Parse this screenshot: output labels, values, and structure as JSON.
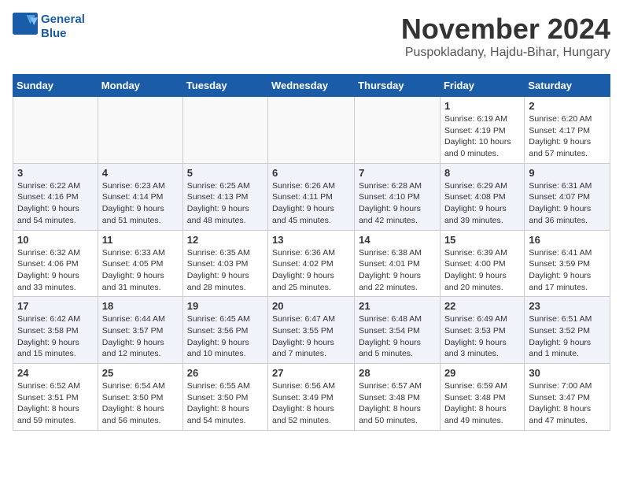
{
  "header": {
    "logo_line1": "General",
    "logo_line2": "Blue",
    "month_year": "November 2024",
    "location": "Puspokladany, Hajdu-Bihar, Hungary"
  },
  "weekdays": [
    "Sunday",
    "Monday",
    "Tuesday",
    "Wednesday",
    "Thursday",
    "Friday",
    "Saturday"
  ],
  "weeks": [
    [
      {
        "day": "",
        "info": ""
      },
      {
        "day": "",
        "info": ""
      },
      {
        "day": "",
        "info": ""
      },
      {
        "day": "",
        "info": ""
      },
      {
        "day": "",
        "info": ""
      },
      {
        "day": "1",
        "info": "Sunrise: 6:19 AM\nSunset: 4:19 PM\nDaylight: 10 hours\nand 0 minutes."
      },
      {
        "day": "2",
        "info": "Sunrise: 6:20 AM\nSunset: 4:17 PM\nDaylight: 9 hours\nand 57 minutes."
      }
    ],
    [
      {
        "day": "3",
        "info": "Sunrise: 6:22 AM\nSunset: 4:16 PM\nDaylight: 9 hours\nand 54 minutes."
      },
      {
        "day": "4",
        "info": "Sunrise: 6:23 AM\nSunset: 4:14 PM\nDaylight: 9 hours\nand 51 minutes."
      },
      {
        "day": "5",
        "info": "Sunrise: 6:25 AM\nSunset: 4:13 PM\nDaylight: 9 hours\nand 48 minutes."
      },
      {
        "day": "6",
        "info": "Sunrise: 6:26 AM\nSunset: 4:11 PM\nDaylight: 9 hours\nand 45 minutes."
      },
      {
        "day": "7",
        "info": "Sunrise: 6:28 AM\nSunset: 4:10 PM\nDaylight: 9 hours\nand 42 minutes."
      },
      {
        "day": "8",
        "info": "Sunrise: 6:29 AM\nSunset: 4:08 PM\nDaylight: 9 hours\nand 39 minutes."
      },
      {
        "day": "9",
        "info": "Sunrise: 6:31 AM\nSunset: 4:07 PM\nDaylight: 9 hours\nand 36 minutes."
      }
    ],
    [
      {
        "day": "10",
        "info": "Sunrise: 6:32 AM\nSunset: 4:06 PM\nDaylight: 9 hours\nand 33 minutes."
      },
      {
        "day": "11",
        "info": "Sunrise: 6:33 AM\nSunset: 4:05 PM\nDaylight: 9 hours\nand 31 minutes."
      },
      {
        "day": "12",
        "info": "Sunrise: 6:35 AM\nSunset: 4:03 PM\nDaylight: 9 hours\nand 28 minutes."
      },
      {
        "day": "13",
        "info": "Sunrise: 6:36 AM\nSunset: 4:02 PM\nDaylight: 9 hours\nand 25 minutes."
      },
      {
        "day": "14",
        "info": "Sunrise: 6:38 AM\nSunset: 4:01 PM\nDaylight: 9 hours\nand 22 minutes."
      },
      {
        "day": "15",
        "info": "Sunrise: 6:39 AM\nSunset: 4:00 PM\nDaylight: 9 hours\nand 20 minutes."
      },
      {
        "day": "16",
        "info": "Sunrise: 6:41 AM\nSunset: 3:59 PM\nDaylight: 9 hours\nand 17 minutes."
      }
    ],
    [
      {
        "day": "17",
        "info": "Sunrise: 6:42 AM\nSunset: 3:58 PM\nDaylight: 9 hours\nand 15 minutes."
      },
      {
        "day": "18",
        "info": "Sunrise: 6:44 AM\nSunset: 3:57 PM\nDaylight: 9 hours\nand 12 minutes."
      },
      {
        "day": "19",
        "info": "Sunrise: 6:45 AM\nSunset: 3:56 PM\nDaylight: 9 hours\nand 10 minutes."
      },
      {
        "day": "20",
        "info": "Sunrise: 6:47 AM\nSunset: 3:55 PM\nDaylight: 9 hours\nand 7 minutes."
      },
      {
        "day": "21",
        "info": "Sunrise: 6:48 AM\nSunset: 3:54 PM\nDaylight: 9 hours\nand 5 minutes."
      },
      {
        "day": "22",
        "info": "Sunrise: 6:49 AM\nSunset: 3:53 PM\nDaylight: 9 hours\nand 3 minutes."
      },
      {
        "day": "23",
        "info": "Sunrise: 6:51 AM\nSunset: 3:52 PM\nDaylight: 9 hours\nand 1 minute."
      }
    ],
    [
      {
        "day": "24",
        "info": "Sunrise: 6:52 AM\nSunset: 3:51 PM\nDaylight: 8 hours\nand 59 minutes."
      },
      {
        "day": "25",
        "info": "Sunrise: 6:54 AM\nSunset: 3:50 PM\nDaylight: 8 hours\nand 56 minutes."
      },
      {
        "day": "26",
        "info": "Sunrise: 6:55 AM\nSunset: 3:50 PM\nDaylight: 8 hours\nand 54 minutes."
      },
      {
        "day": "27",
        "info": "Sunrise: 6:56 AM\nSunset: 3:49 PM\nDaylight: 8 hours\nand 52 minutes."
      },
      {
        "day": "28",
        "info": "Sunrise: 6:57 AM\nSunset: 3:48 PM\nDaylight: 8 hours\nand 50 minutes."
      },
      {
        "day": "29",
        "info": "Sunrise: 6:59 AM\nSunset: 3:48 PM\nDaylight: 8 hours\nand 49 minutes."
      },
      {
        "day": "30",
        "info": "Sunrise: 7:00 AM\nSunset: 3:47 PM\nDaylight: 8 hours\nand 47 minutes."
      }
    ]
  ]
}
